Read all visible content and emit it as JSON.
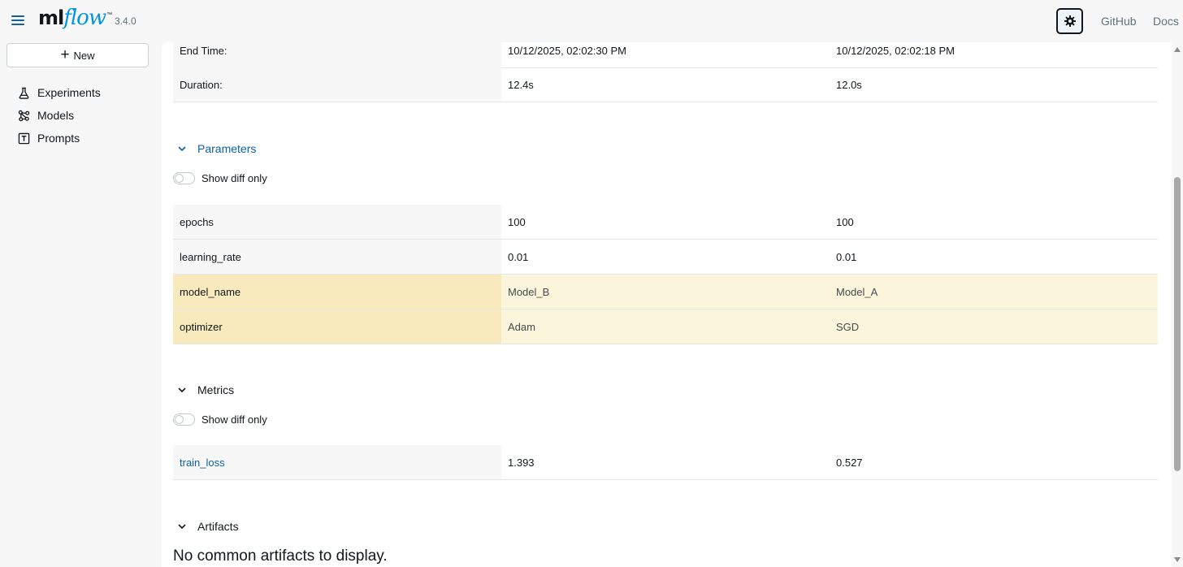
{
  "header": {
    "logo_ml": "ml",
    "logo_flow": "flow",
    "logo_tm": "™",
    "version": "3.4.0",
    "links": {
      "github": "GitHub",
      "docs": "Docs"
    }
  },
  "sidebar": {
    "new_label": "New",
    "items": [
      {
        "label": "Experiments",
        "icon": "flask-icon"
      },
      {
        "label": "Models",
        "icon": "models-icon"
      },
      {
        "label": "Prompts",
        "icon": "prompt-icon"
      }
    ]
  },
  "run_info": {
    "rows": [
      {
        "label": "End Time:",
        "run1": "10/12/2025, 02:02:30 PM",
        "run2": "10/12/2025, 02:02:18 PM"
      },
      {
        "label": "Duration:",
        "run1": "12.4s",
        "run2": "12.0s"
      }
    ]
  },
  "parameters": {
    "title": "Parameters",
    "toggle_label": "Show diff only",
    "rows": [
      {
        "name": "epochs",
        "run1": "100",
        "run2": "100",
        "diff": false
      },
      {
        "name": "learning_rate",
        "run1": "0.01",
        "run2": "0.01",
        "diff": false
      },
      {
        "name": "model_name",
        "run1": "Model_B",
        "run2": "Model_A",
        "diff": true
      },
      {
        "name": "optimizer",
        "run1": "Adam",
        "run2": "SGD",
        "diff": true
      }
    ]
  },
  "metrics": {
    "title": "Metrics",
    "toggle_label": "Show diff only",
    "rows": [
      {
        "name": "train_loss",
        "run1": "1.393",
        "run2": "0.527"
      }
    ]
  },
  "artifacts": {
    "title": "Artifacts",
    "empty_message": "No common artifacts to display."
  },
  "colors": {
    "accent": "#0e5fa3",
    "diff_label_bg": "#f8eabd",
    "diff_value_bg": "#fbf5dc"
  }
}
